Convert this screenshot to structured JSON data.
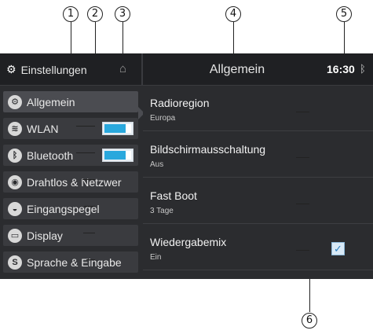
{
  "callouts": [
    "1",
    "2",
    "3",
    "4",
    "5",
    "6"
  ],
  "header": {
    "settings_icon": "gears-icon",
    "settings_title": "Einstellungen",
    "home_icon": "home-icon",
    "page_title": "Allgemein",
    "clock": "16:30",
    "status_icon": "bluetooth-icon"
  },
  "sidebar": {
    "items": [
      {
        "label": "Allgemein",
        "icon": "gear-icon",
        "active": true
      },
      {
        "label": "WLAN",
        "icon": "wifi-icon",
        "toggle_on": true
      },
      {
        "label": "Bluetooth",
        "icon": "bluetooth-icon",
        "toggle_on": true
      },
      {
        "label": "Drahtlos & Netzwer",
        "icon": "network-icon"
      },
      {
        "label": "Eingangspegel",
        "icon": "input-level-icon"
      },
      {
        "label": "Display",
        "icon": "display-icon"
      },
      {
        "label": "Sprache & Eingabe",
        "icon": "language-icon"
      }
    ]
  },
  "settings": [
    {
      "title": "Radioregion",
      "value": "Europa"
    },
    {
      "title": "Bildschirmausschaltung",
      "value": "Aus"
    },
    {
      "title": "Fast Boot",
      "value": "3 Tage"
    },
    {
      "title": "Wiedergabemix",
      "value": "Ein",
      "checked": true
    }
  ],
  "colors": {
    "accent": "#29a8dd",
    "background": "#2b2c2f"
  }
}
